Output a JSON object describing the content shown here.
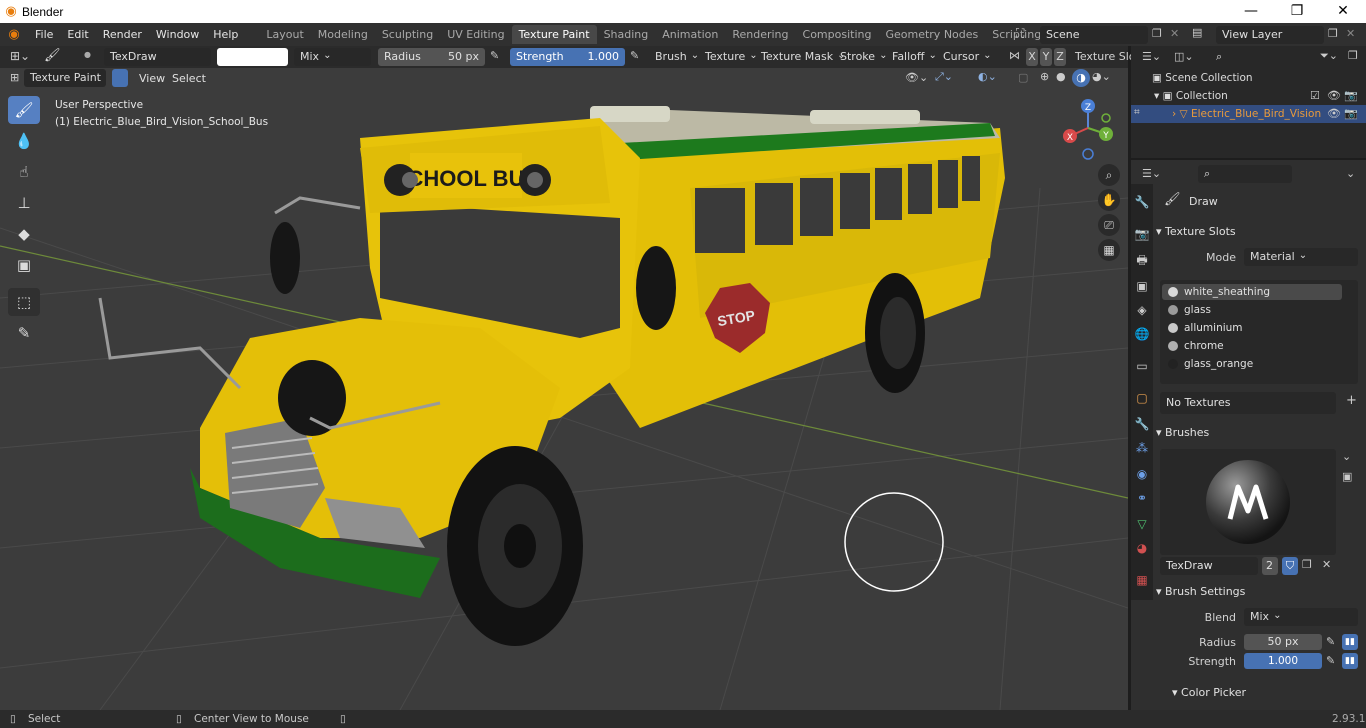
{
  "window": {
    "app_title": "Blender",
    "minimize": "—",
    "maximize": "❐",
    "close": "✕"
  },
  "menus": [
    "File",
    "Edit",
    "Render",
    "Window",
    "Help"
  ],
  "workspace_tabs": [
    {
      "label": "Layout"
    },
    {
      "label": "Modeling"
    },
    {
      "label": "Sculpting"
    },
    {
      "label": "UV Editing"
    },
    {
      "label": "Texture Paint",
      "active": true
    },
    {
      "label": "Shading"
    },
    {
      "label": "Animation"
    },
    {
      "label": "Rendering"
    },
    {
      "label": "Compositing"
    },
    {
      "label": "Geometry Nodes"
    },
    {
      "label": "Scripting"
    }
  ],
  "add_workspace": "+",
  "scene": {
    "name": "Scene",
    "view_layer": "View Layer"
  },
  "tool_header": {
    "brush_name": "TexDraw",
    "blend": "Mix",
    "radius_label": "Radius",
    "radius_value": "50 px",
    "strength_label": "Strength",
    "strength_value": "1.000",
    "menus": [
      "Brush",
      "Texture",
      "Texture Mask",
      "Stroke",
      "Falloff",
      "Cursor"
    ],
    "axes": [
      "X",
      "Y",
      "Z"
    ],
    "texture_slots": "Texture Slots"
  },
  "mode_header": {
    "mode": "Texture Paint",
    "view": "View",
    "select": "Select"
  },
  "viewport": {
    "perspective": "User Perspective",
    "object_label": "(1) Electric_Blue_Bird_Vision_School_Bus",
    "bus_sign": "SCHOOL BUS",
    "stop_sign": "STOP",
    "gizmo_x": "X",
    "gizmo_y": "Y",
    "gizmo_z": "Z"
  },
  "outliner": {
    "scene_collection": "Scene Collection",
    "collection": "Collection",
    "object": "Electric_Blue_Bird_Vision"
  },
  "properties": {
    "tool_name": "Draw",
    "texture_slots_header": "Texture Slots",
    "mode_label": "Mode",
    "mode_value": "Material",
    "slots": [
      {
        "name": "white_sheathing",
        "color": "#d8d8d8",
        "selected": true
      },
      {
        "name": "glass",
        "color": "#9a9a9a"
      },
      {
        "name": "alluminium",
        "color": "#c9c9c9"
      },
      {
        "name": "chrome",
        "color": "#b0b0b0"
      },
      {
        "name": "glass_orange",
        "color": "#222222"
      }
    ],
    "no_textures": "No Textures",
    "brushes_header": "Brushes",
    "brush_name": "TexDraw",
    "brush_users": "2",
    "brush_settings_header": "Brush Settings",
    "blend_label": "Blend",
    "blend_value": "Mix",
    "radius_label": "Radius",
    "radius_value": "50 px",
    "strength_label": "Strength",
    "strength_value": "1.000",
    "color_picker": "Color Picker"
  },
  "status": {
    "left": "Select",
    "middle": "Center View to Mouse",
    "version": "2.93.1"
  },
  "colors": {
    "accent": "#4772b3",
    "active_tool": "#5680c2",
    "bus_yellow": "#e8c40a",
    "bus_green": "#1a6b1a",
    "selected_object": "#e89a3c"
  }
}
